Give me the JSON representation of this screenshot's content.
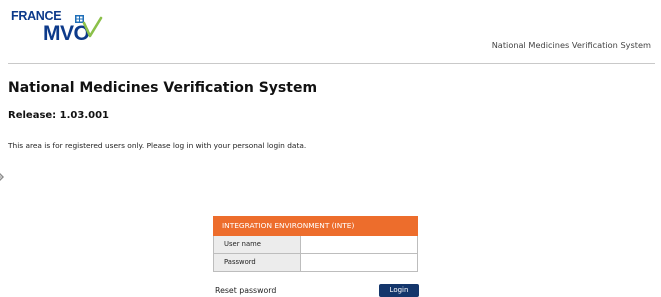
{
  "logo": {
    "line1": "FRANCE",
    "line2": "MVO",
    "name": "france-mvo-logo",
    "colors": {
      "text": "#0d3a8a",
      "accent": "#8bc04a",
      "mark_fill": "#1f6fb8"
    }
  },
  "header": {
    "system_name": "National Medicines Verification System"
  },
  "main": {
    "title": "National Medicines Verification System",
    "release": "Release: 1.03.001",
    "notice": "This area is for registered users only. Please log in with your personal login data."
  },
  "login": {
    "environment_label": "INTEGRATION ENVIRONMENT (INTE)",
    "username_label": "User name",
    "username_value": "",
    "password_label": "Password",
    "password_value": "",
    "reset_link": "Reset password",
    "login_button": "Login"
  },
  "colors": {
    "environment_header_bg": "#ed6d2c",
    "login_button_bg": "#14366b",
    "label_cell_bg": "#ececec"
  },
  "icons": {
    "edge_arrow": "chevron-right-icon"
  }
}
